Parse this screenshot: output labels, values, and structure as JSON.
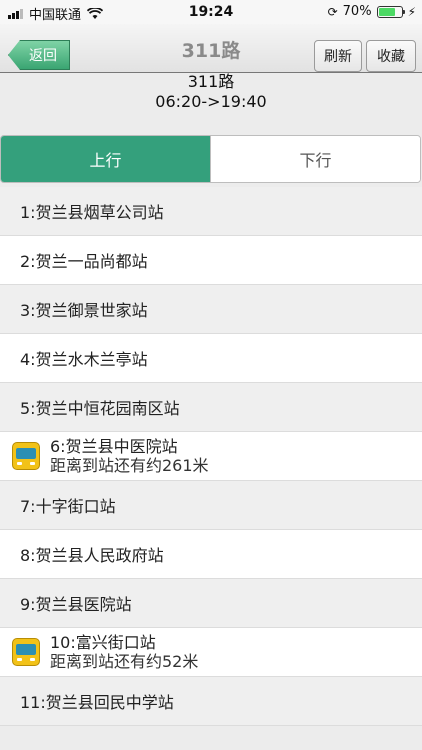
{
  "status_bar": {
    "carrier": "中国联通",
    "time": "19:24",
    "battery_percent": "70%"
  },
  "navbar": {
    "back_label": "返回",
    "title": "311路",
    "refresh_label": "刷新",
    "favorite_label": "收藏"
  },
  "route": {
    "name": "311路",
    "hours": "06:20->19:40"
  },
  "tabs": {
    "up_label": "上行",
    "down_label": "下行"
  },
  "stops": [
    {
      "label": "1:贺兰县烟草公司站"
    },
    {
      "label": "2:贺兰一品尚都站"
    },
    {
      "label": "3:贺兰御景世家站"
    },
    {
      "label": "4:贺兰水木兰亭站"
    },
    {
      "label": "5:贺兰中恒花园南区站"
    },
    {
      "label": "6:贺兰县中医院站",
      "bus_info": "距离到站还有约261米"
    },
    {
      "label": "7:十字街口站"
    },
    {
      "label": "8:贺兰县人民政府站"
    },
    {
      "label": "9:贺兰县医院站"
    },
    {
      "label": "10:富兴街口站",
      "bus_info": "距离到站还有约52米"
    },
    {
      "label": "11:贺兰县回民中学站"
    }
  ],
  "colors": {
    "accent": "#34a07c",
    "bus_icon": "#f2c218"
  }
}
